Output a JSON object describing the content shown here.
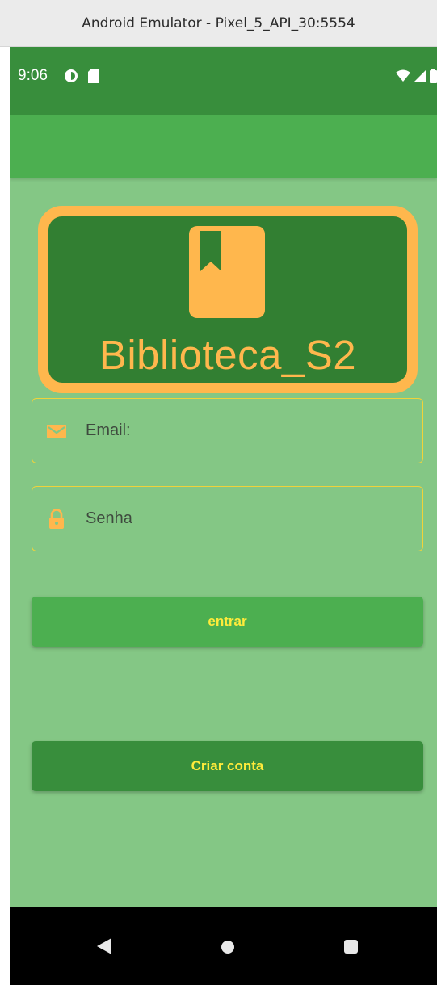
{
  "window": {
    "title": "Android Emulator - Pixel_5_API_30:5554"
  },
  "status_bar": {
    "time": "9:06",
    "left_icons": [
      "data-saver-icon",
      "sd-card-icon"
    ],
    "right_icons": [
      "wifi-icon",
      "signal-icon",
      "battery-icon"
    ]
  },
  "logo": {
    "title": "Biblioteca_S2",
    "icon": "book-bookmark-icon"
  },
  "form": {
    "email_placeholder": "Email:",
    "email_icon": "envelope-icon",
    "password_placeholder": "Senha",
    "password_icon": "lock-icon"
  },
  "buttons": {
    "login_label": "entrar",
    "signup_label": "Criar conta"
  },
  "nav": {
    "icons": [
      "back-icon",
      "home-icon",
      "recents-icon"
    ]
  },
  "colors": {
    "status_bar": "#388e3c",
    "app_bar": "#4caf50",
    "background": "#84c785",
    "accent_orange": "#ffb74d",
    "logo_card": "#327f32",
    "button_text": "#ffeb3b",
    "field_border": "#f0d33a"
  }
}
